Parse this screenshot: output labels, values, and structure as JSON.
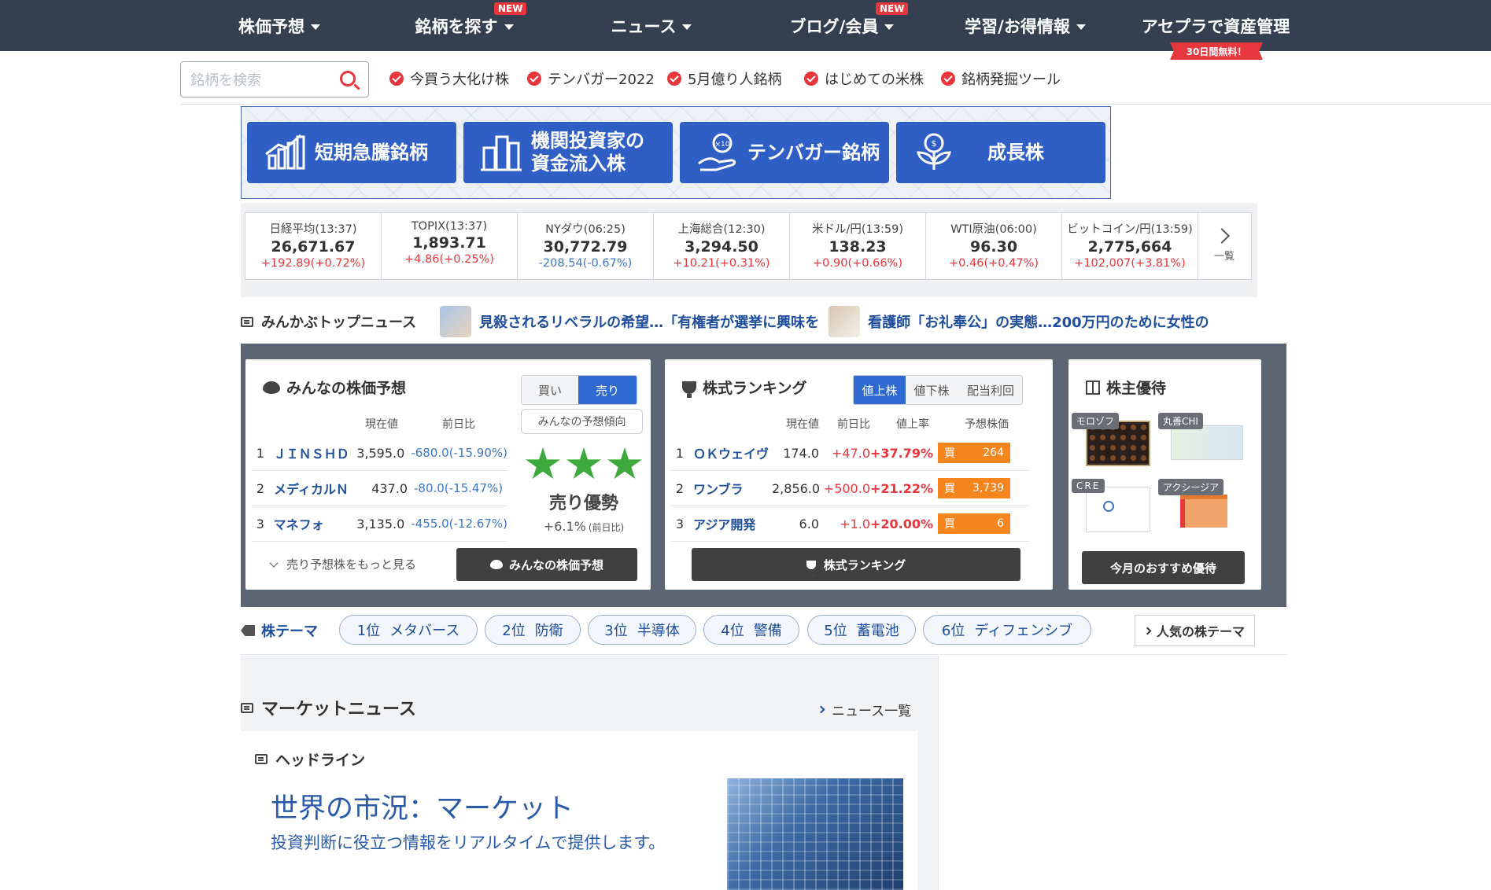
{
  "nav": {
    "items": [
      {
        "label": "株価予想",
        "new": false
      },
      {
        "label": "銘柄を探す",
        "new": true
      },
      {
        "label": "ニュース",
        "new": false
      },
      {
        "label": "ブログ/会員",
        "new": true
      },
      {
        "label": "学習/お得情報",
        "new": false
      }
    ],
    "new_badge": "NEW",
    "asset_label": "アセプラで資産管理",
    "free_ribbon": "30日間無料！"
  },
  "search": {
    "placeholder": "銘柄を検索",
    "quick_links": [
      "今買う大化け株",
      "テンバガー2022",
      "5月億り人銘柄",
      "はじめての米株",
      "銘柄発掘ツール"
    ]
  },
  "banner": {
    "buttons": [
      "短期急騰銘柄",
      "機関投資家の\n資金流入株",
      "テンバガー銘柄",
      "成長株"
    ]
  },
  "ticker": {
    "items": [
      {
        "name": "日経平均(13:37)",
        "value": "26,671.67",
        "change": "+192.89(+0.72%)",
        "dir": "up"
      },
      {
        "name": "TOPIX(13:37)",
        "value": "1,893.71",
        "change": "+4.86(+0.25%)",
        "dir": "up"
      },
      {
        "name": "NYダウ(06:25)",
        "value": "30,772.79",
        "change": "-208.54(-0.67%)",
        "dir": "down"
      },
      {
        "name": "上海総合(12:30)",
        "value": "3,294.50",
        "change": "+10.21(+0.31%)",
        "dir": "up"
      },
      {
        "name": "米ドル/円(13:59)",
        "value": "138.23",
        "change": "+0.90(+0.66%)",
        "dir": "up"
      },
      {
        "name": "WTI原油(06:00)",
        "value": "96.30",
        "change": "+0.46(+0.47%)",
        "dir": "up"
      },
      {
        "name": "ビットコイン/円(13:59)",
        "value": "2,775,664",
        "change": "+102,007(+3.81%)",
        "dir": "up"
      }
    ],
    "more_label": "一覧"
  },
  "top_news": {
    "title": "みんかぶトップニュース",
    "headlines": [
      "見殺されるリベラルの希望…「有権者が選挙に興味を",
      "看護師「お礼奉公」の実態…200万円のために女性の"
    ]
  },
  "forecast": {
    "title": "みんなの株価予想",
    "tab_buy": "買い",
    "tab_sell": "売り",
    "col_price": "現在値",
    "col_change": "前日比",
    "rows": [
      {
        "rank": "1",
        "name": "ＪＩＮＳＨＤ",
        "price": "3,595.0",
        "change": "-680.0(-15.90%)"
      },
      {
        "rank": "2",
        "name": "メディカルＮ",
        "price": "437.0",
        "change": "-80.0(-15.47%)"
      },
      {
        "rank": "3",
        "name": "マネフォ",
        "price": "3,135.0",
        "change": "-455.0(-12.67%)"
      }
    ],
    "tendency_label": "みんなの予想傾向",
    "verdict": "売り優勢",
    "verdict_pct": "+6.1%",
    "verdict_note": "(前日比)",
    "stars": 3,
    "more_link": "売り予想株をもっと見る",
    "button": "みんなの株価予想"
  },
  "ranking": {
    "title": "株式ランキング",
    "tabs": [
      "値上株",
      "値下株",
      "配当利回"
    ],
    "col_price": "現在値",
    "col_change": "前日比",
    "col_rate": "値上率",
    "col_target": "予想株価",
    "buy_label": "買",
    "rows": [
      {
        "rank": "1",
        "name": "ＯＫウェイヴ",
        "price": "174.0",
        "change": "+47.0",
        "rate": "+37.79%",
        "target": "264"
      },
      {
        "rank": "2",
        "name": "ワンブラ",
        "price": "2,856.0",
        "change": "+500.0",
        "rate": "+21.22%",
        "target": "3,739"
      },
      {
        "rank": "3",
        "name": "アジア開発",
        "price": "6.0",
        "change": "+1.0",
        "rate": "+20.00%",
        "target": "6"
      }
    ],
    "button": "株式ランキング"
  },
  "yutai": {
    "title": "株主優待",
    "items": [
      "モロゾフ",
      "丸善CHI",
      "CRE",
      "アクシージア"
    ],
    "button": "今月のおすすめ優待"
  },
  "themes": {
    "title": "株テーマ",
    "chips": [
      {
        "rank": "1位",
        "name": "メタバース"
      },
      {
        "rank": "2位",
        "name": "防衛"
      },
      {
        "rank": "3位",
        "name": "半導体"
      },
      {
        "rank": "4位",
        "name": "警備"
      },
      {
        "rank": "5位",
        "name": "蓄電池"
      },
      {
        "rank": "6位",
        "name": "ディフェンシブ"
      }
    ],
    "more": "人気の株テーマ"
  },
  "market_news": {
    "title": "マーケットニュース",
    "more": "ニュース一覧",
    "headline_label": "ヘッドライン",
    "main_title": "世界の市況：マーケット",
    "main_sub": "投資判断に役立つ情報をリアルタイムで提供します。"
  },
  "colors": {
    "nav_bg": "#34404f",
    "accent_red": "#e8363d",
    "banner_blue": "#2f5fc5",
    "up": "#e8363d",
    "down": "#3e78c4",
    "star_green": "#3eaa3e",
    "buy_orange": "#f5851f"
  }
}
